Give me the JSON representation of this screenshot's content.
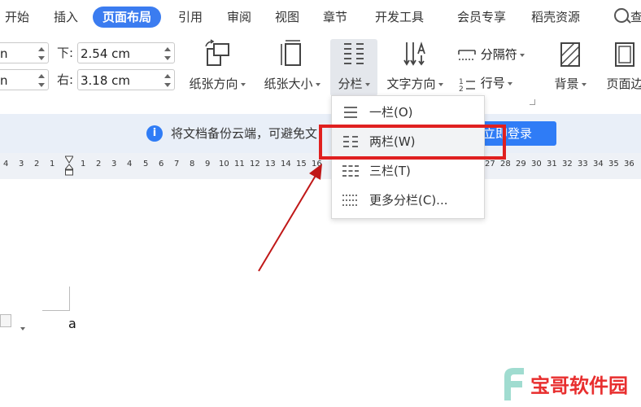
{
  "menu": {
    "tabs": [
      {
        "label": "开始"
      },
      {
        "label": "插入"
      },
      {
        "label": "页面布局"
      },
      {
        "label": "引用"
      },
      {
        "label": "审阅"
      },
      {
        "label": "视图"
      },
      {
        "label": "章节"
      },
      {
        "label": "开发工具"
      },
      {
        "label": "会员专享"
      },
      {
        "label": "稻壳资源"
      }
    ],
    "search_partial": "查"
  },
  "ribbon": {
    "margins": {
      "top_left_value": "n",
      "bottom_left_value": "n",
      "bottom_label": "下:",
      "bottom_value": "2.54 cm",
      "right_label": "右:",
      "right_value": "3.18 cm"
    },
    "buttons": {
      "orientation": "纸张方向",
      "size": "纸张大小",
      "columns": "分栏",
      "text_direction": "文字方向",
      "separator": "分隔符",
      "line_numbers": "行号",
      "background": "背景",
      "page_border": "页面边"
    }
  },
  "infobar": {
    "icon": "i",
    "text": "将文档备份云端，可避免",
    "text_tail": "文",
    "login_label": "立即登录"
  },
  "ruler": {
    "left_numbers": [
      "4",
      "3",
      "2",
      "1"
    ],
    "right_numbers": [
      "1",
      "2",
      "3",
      "4",
      "5",
      "6",
      "7",
      "8",
      "9",
      "10",
      "11",
      "12",
      "13",
      "14",
      "15",
      "16"
    ],
    "far_numbers": [
      "27",
      "28",
      "29",
      "30",
      "31",
      "32",
      "33",
      "34",
      "35",
      "36"
    ]
  },
  "columns_menu": {
    "items": [
      {
        "label": "一栏(O)",
        "icon": "one-column-icon"
      },
      {
        "label": "两栏(W)",
        "icon": "two-column-icon"
      },
      {
        "label": "三栏(T)",
        "icon": "three-column-icon"
      },
      {
        "label": "更多分栏(C)...",
        "icon": "more-columns-icon"
      }
    ]
  },
  "document": {
    "text": "a"
  },
  "watermark": {
    "text": "宝哥软件园"
  },
  "colors": {
    "accent": "#3b7cf0",
    "highlight_red": "#e02020",
    "infobar_bg": "#e9eff8",
    "login_blue": "#2f7cf6"
  }
}
